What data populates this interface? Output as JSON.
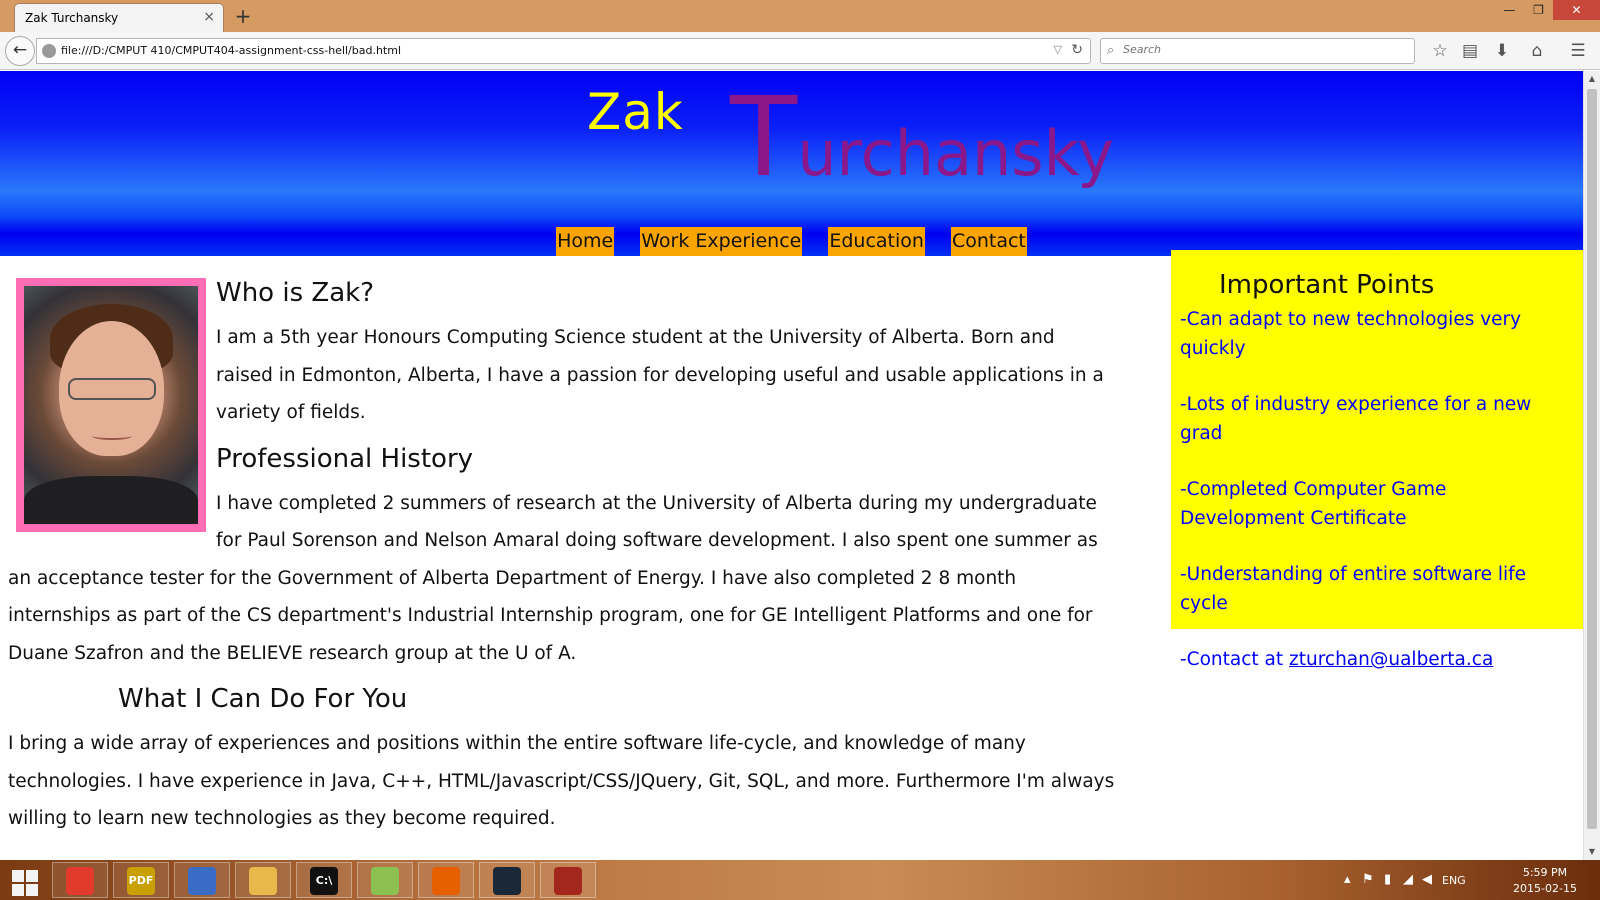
{
  "browser": {
    "tab_title": "Zak Turchansky",
    "tab_close": "×",
    "new_tab": "+",
    "url": "file:///D:/CMPUT 410/CMPUT404-assignment-css-hell/bad.html",
    "search_placeholder": "Search",
    "window_controls": [
      "—",
      "❐",
      "✕"
    ]
  },
  "header": {
    "first_name": "Zak",
    "last_name_initial": "T",
    "last_name_rest": "urchansky",
    "nav": [
      "Home",
      "Work Experience",
      "Education",
      "Contact"
    ]
  },
  "main": {
    "sections": [
      {
        "heading": "Who is Zak?",
        "text": "I am a 5th year Honours Computing Science student at the University of Alberta. Born and raised in Edmonton, Alberta, I have a passion for developing useful and usable applications in a variety of fields."
      },
      {
        "heading": "Professional History",
        "text": "I have completed 2 summers of research at the University of Alberta during my undergraduate for Paul Sorenson and Nelson Amaral doing software development. I also spent one summer as an acceptance tester for the Government of Alberta Department of Energy. I have also completed 2 8 month internships as part of the CS department's Industrial Internship program, one for GE Intelligent Platforms and one for Duane Szafron and the BELIEVE research group at the U of A."
      },
      {
        "heading": "What I Can Do For You",
        "text": "I bring a wide array of experiences and positions within the entire software life-cycle, and knowledge of many technologies. I have experience in Java, C++, HTML/Javascript/CSS/JQuery, Git, SQL, and more. Furthermore I'm always willing to learn new technologies as they become required."
      }
    ]
  },
  "sidebar": {
    "title": "Important Points",
    "points": [
      "-Can adapt to new technologies very quickly",
      "-Lots of industry experience for a new grad",
      "-Completed Computer Game Development Certificate",
      "-Understanding of entire software life cycle"
    ],
    "contact_prefix": "-Contact at ",
    "contact_email": "zturchan@ualberta.ca"
  },
  "taskbar": {
    "apps": [
      {
        "name": "chrome-icon",
        "label": "",
        "color": "#e23b2e"
      },
      {
        "name": "pdf-icon",
        "label": "PDF",
        "color": "#c9a000"
      },
      {
        "name": "network-icon",
        "label": "",
        "color": "#3b6cc5"
      },
      {
        "name": "file-explorer-icon",
        "label": "",
        "color": "#e8b84a"
      },
      {
        "name": "command-prompt-icon",
        "label": "C:\\",
        "color": "#111111"
      },
      {
        "name": "notepad-plus-icon",
        "label": "",
        "color": "#8cc152"
      },
      {
        "name": "firefox-icon",
        "label": "",
        "color": "#e66000"
      },
      {
        "name": "steam-icon",
        "label": "",
        "color": "#1b2838"
      },
      {
        "name": "dota-icon",
        "label": "",
        "color": "#a3271d"
      }
    ],
    "language": "ENG",
    "time": "5:59 PM",
    "date": "2015-02-15"
  }
}
